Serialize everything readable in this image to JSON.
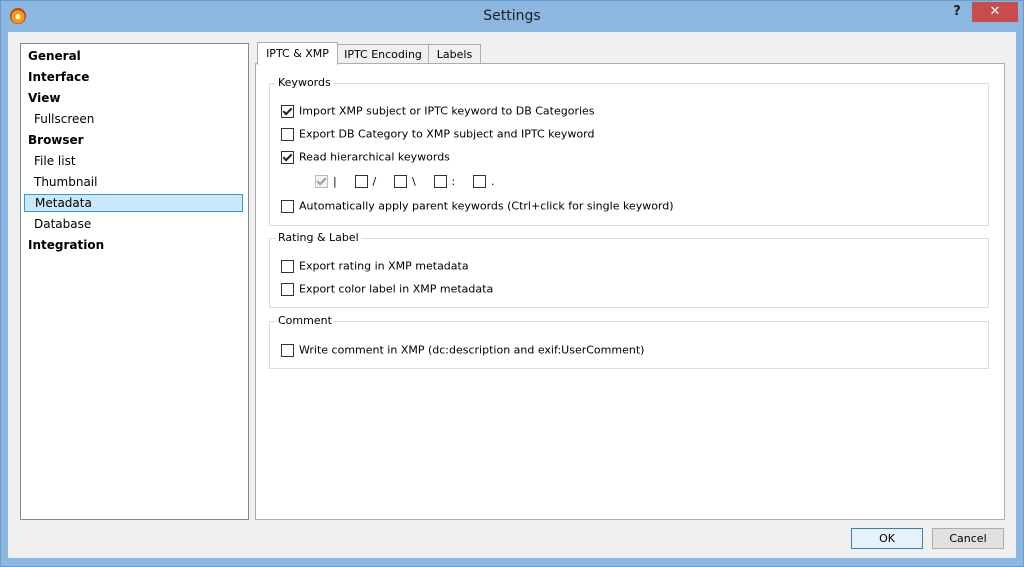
{
  "window": {
    "title": "Settings",
    "help_glyph": "?",
    "close_glyph": "✕"
  },
  "nav": {
    "items": [
      {
        "label": "General",
        "level": "top"
      },
      {
        "label": "Interface",
        "level": "top"
      },
      {
        "label": "View",
        "level": "top"
      },
      {
        "label": "Fullscreen",
        "level": "sub"
      },
      {
        "label": "Browser",
        "level": "top"
      },
      {
        "label": "File list",
        "level": "sub"
      },
      {
        "label": "Thumbnail",
        "level": "sub"
      },
      {
        "label": "Metadata",
        "level": "sub",
        "selected": true
      },
      {
        "label": "Database",
        "level": "sub"
      },
      {
        "label": "Integration",
        "level": "top"
      }
    ]
  },
  "tabs": [
    {
      "label": "IPTC & XMP",
      "active": true
    },
    {
      "label": "IPTC Encoding",
      "active": false
    },
    {
      "label": "Labels",
      "active": false
    }
  ],
  "keywords": {
    "title": "Keywords",
    "import": {
      "label": "Import XMP subject or IPTC keyword to DB Categories",
      "checked": true
    },
    "export": {
      "label": "Export DB Category to XMP subject and IPTC keyword",
      "checked": false
    },
    "hierarchical": {
      "label": "Read hierarchical keywords",
      "checked": true
    },
    "separators": [
      {
        "char": "|",
        "checked": true,
        "disabled": true
      },
      {
        "char": "/",
        "checked": false
      },
      {
        "char": "\\",
        "checked": false
      },
      {
        "char": ":",
        "checked": false
      },
      {
        "char": ".",
        "checked": false
      }
    ],
    "auto_parent": {
      "label": "Automatically apply parent keywords (Ctrl+click for single keyword)",
      "checked": false
    }
  },
  "rating": {
    "title": "Rating & Label",
    "export_rating": {
      "label": "Export rating in XMP metadata",
      "checked": false
    },
    "export_color": {
      "label": "Export color label in XMP metadata",
      "checked": false
    }
  },
  "comment": {
    "title": "Comment",
    "write_comment": {
      "label": "Write comment in XMP (dc:description and exif:UserComment)",
      "checked": false
    }
  },
  "buttons": {
    "ok": "OK",
    "cancel": "Cancel"
  }
}
